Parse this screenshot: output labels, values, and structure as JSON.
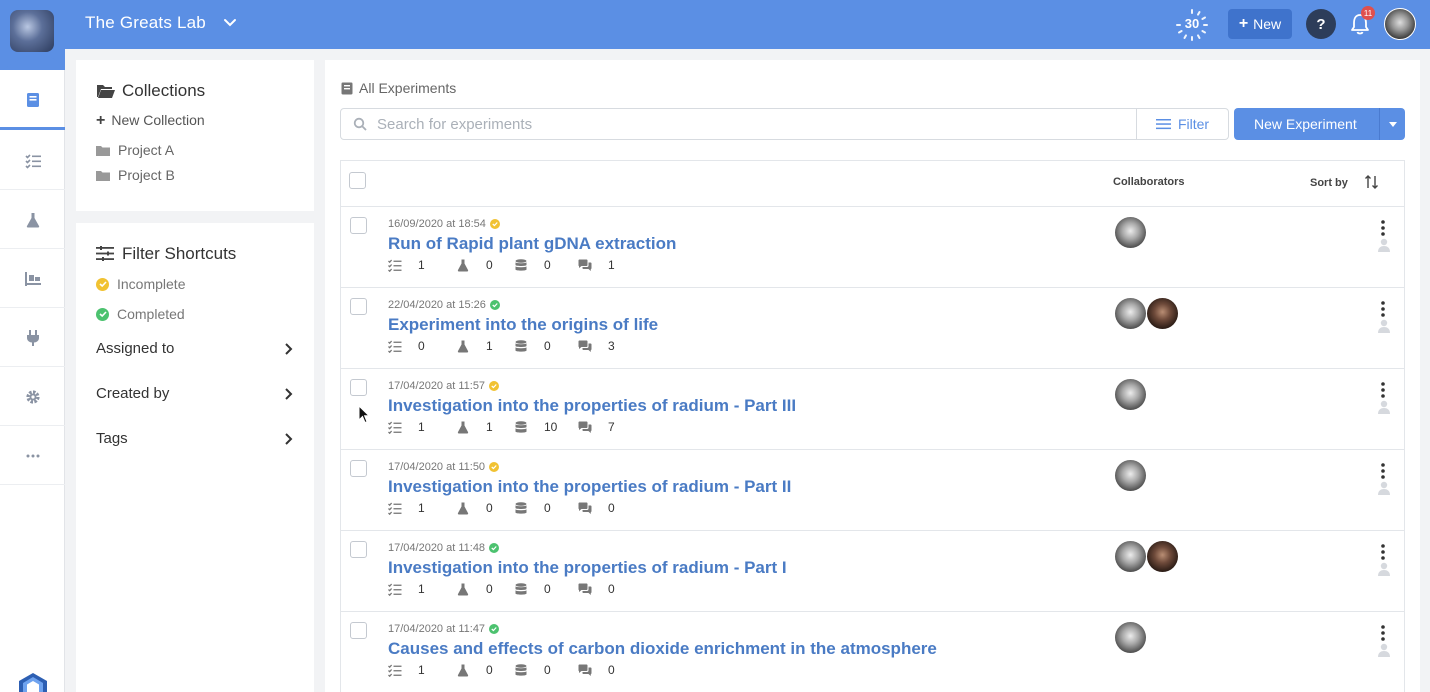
{
  "header": {
    "lab_name": "The Greats Lab",
    "timer_value": "30",
    "new_label": "New",
    "help_label": "?",
    "notifications_count": "11"
  },
  "collections": {
    "title": "Collections",
    "new_label": "New Collection",
    "items": [
      "Project A",
      "Project B"
    ]
  },
  "filter_shortcuts": {
    "title": "Filter Shortcuts",
    "incomplete_label": "Incomplete",
    "completed_label": "Completed",
    "assigned_label": "Assigned to",
    "created_label": "Created by",
    "tags_label": "Tags"
  },
  "main": {
    "breadcrumb": "All Experiments",
    "search_placeholder": "Search for experiments",
    "filter_label": "Filter",
    "new_experiment_label": "New Experiment",
    "col_collaborators": "Collaborators",
    "col_sort": "Sort by"
  },
  "colors": {
    "primary": "#5b8fe4",
    "incomplete": "#f1c232",
    "complete": "#4cc26f"
  },
  "experiments": [
    {
      "date": "16/09/2020 at 18:54",
      "status": "incomplete",
      "title": "Run of Rapid plant gDNA extraction",
      "steps": "1",
      "samples": "0",
      "data": "0",
      "comments": "1",
      "collaborators": [
        "a"
      ]
    },
    {
      "date": "22/04/2020 at 15:26",
      "status": "complete",
      "title": "Experiment into the origins of life",
      "steps": "0",
      "samples": "1",
      "data": "0",
      "comments": "3",
      "collaborators": [
        "a",
        "b"
      ]
    },
    {
      "date": "17/04/2020 at 11:57",
      "status": "incomplete",
      "title": "Investigation into the properties of radium - Part III",
      "steps": "1",
      "samples": "1",
      "data": "10",
      "comments": "7",
      "collaborators": [
        "a"
      ]
    },
    {
      "date": "17/04/2020 at 11:50",
      "status": "incomplete",
      "title": "Investigation into the properties of radium - Part II",
      "steps": "1",
      "samples": "0",
      "data": "0",
      "comments": "0",
      "collaborators": [
        "a"
      ]
    },
    {
      "date": "17/04/2020 at 11:48",
      "status": "complete",
      "title": "Investigation into the properties of radium - Part I",
      "steps": "1",
      "samples": "0",
      "data": "0",
      "comments": "0",
      "collaborators": [
        "a",
        "b"
      ]
    },
    {
      "date": "17/04/2020 at 11:47",
      "status": "complete",
      "title": "Causes and effects of carbon dioxide enrichment in the atmosphere",
      "steps": "1",
      "samples": "0",
      "data": "0",
      "comments": "0",
      "collaborators": [
        "a"
      ]
    }
  ]
}
